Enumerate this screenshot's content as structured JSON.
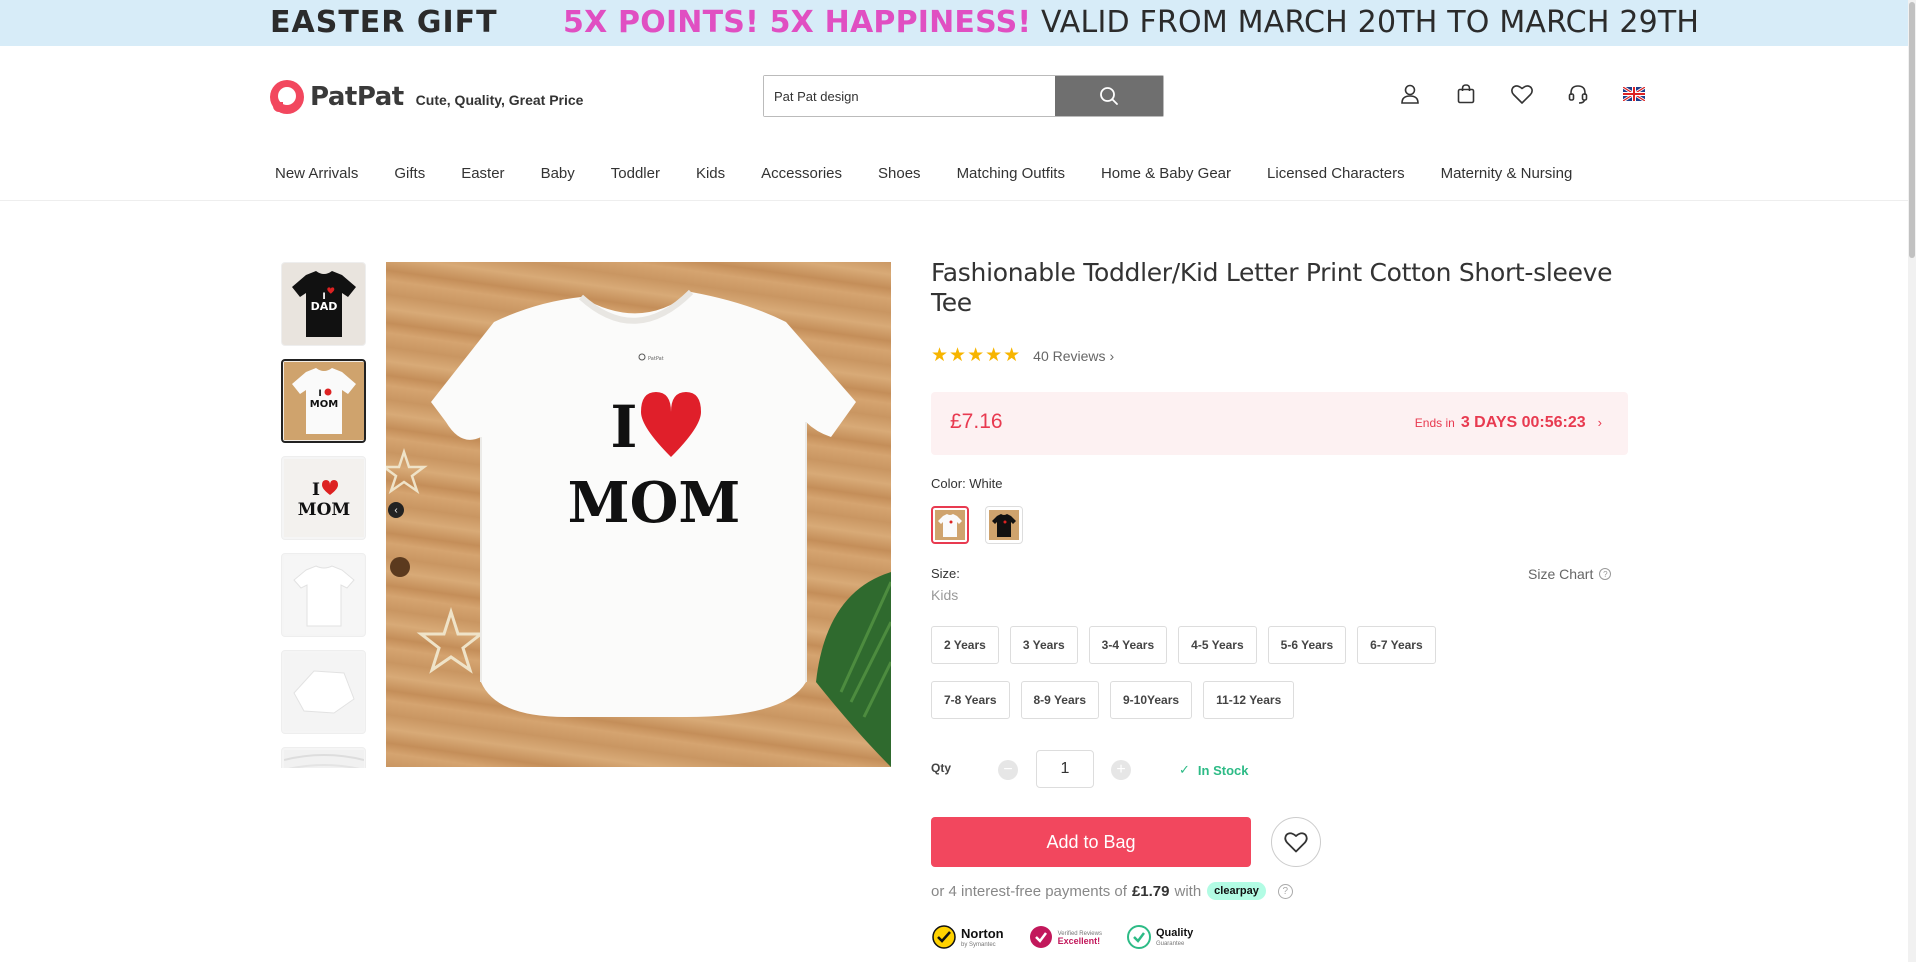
{
  "promo": {
    "left": "EASTER GIFT",
    "highlight": "5X POINTS! 5X HAPPINESS!",
    "rest": " VALID FROM MARCH 20TH TO MARCH 29TH"
  },
  "header": {
    "logo": "PatPat",
    "tagline": "Cute, Quality, Great Price",
    "search_value": "Pat Pat design",
    "icons": [
      "account-icon",
      "bag-icon",
      "wishlist-icon",
      "support-icon",
      "uk-flag-icon"
    ]
  },
  "nav": [
    "New Arrivals",
    "Gifts",
    "Easter",
    "Baby",
    "Toddler",
    "Kids",
    "Accessories",
    "Shoes",
    "Matching Outfits",
    "Home & Baby Gear",
    "Licensed Characters",
    "Maternity & Nursing"
  ],
  "gallery": {
    "thumbs": [
      {
        "name": "thumb-dad-black",
        "line1": "I",
        "line2": "DAD",
        "style": "black"
      },
      {
        "name": "thumb-mom-white",
        "line1": "I",
        "line2": "MOM",
        "style": "white"
      },
      {
        "name": "thumb-mom-closeup",
        "line1": "I",
        "line2": "MOM",
        "style": "closeup"
      },
      {
        "name": "thumb-back",
        "style": "plain"
      },
      {
        "name": "thumb-sleeve",
        "style": "sleeve"
      },
      {
        "name": "thumb-detail",
        "style": "detail"
      }
    ],
    "main_line1": "I",
    "main_line2": "MOM",
    "main_brand": "PatPat"
  },
  "product": {
    "title": "Fashionable Toddler/Kid Letter Print Cotton Short-sleeve Tee",
    "stars": "★★★★★",
    "reviews": "40  Reviews",
    "reviews_chevron": "›",
    "price": "£7.16",
    "ends_label": "Ends in",
    "countdown": "3 DAYS 00:56:23",
    "countdown_chevron": "›",
    "color_label": "Color: White",
    "size_label": "Size:",
    "size_sub": "Kids",
    "size_chart": "Size Chart",
    "sizes": [
      "2 Years",
      "3 Years",
      "3-4 Years",
      "4-5 Years",
      "5-6 Years",
      "6-7 Years",
      "7-8 Years",
      "8-9 Years",
      "9-10Years",
      "11-12 Years"
    ],
    "qty_label": "Qty",
    "qty_value": "1",
    "qty_minus": "−",
    "qty_plus": "+",
    "stock": "In Stock",
    "add_to_bag": "Add to Bag",
    "pay_prefix": "or 4 interest-free payments of",
    "pay_amount": "£1.79",
    "pay_with": "with",
    "clearpay": "clearpay",
    "help_mark": "?",
    "badges": [
      {
        "title": "Norton",
        "sub": "by Symantec"
      },
      {
        "title": "Excellent!",
        "sub": "Verified Reviews"
      },
      {
        "title": "Quality",
        "sub": "Guarantee"
      }
    ]
  },
  "colors": {
    "accent": "#f2475e",
    "promo_bg": "#d7ecf8",
    "promo_pink": "#e04fc2",
    "star": "#f7b500",
    "stock": "#2dbb86"
  }
}
